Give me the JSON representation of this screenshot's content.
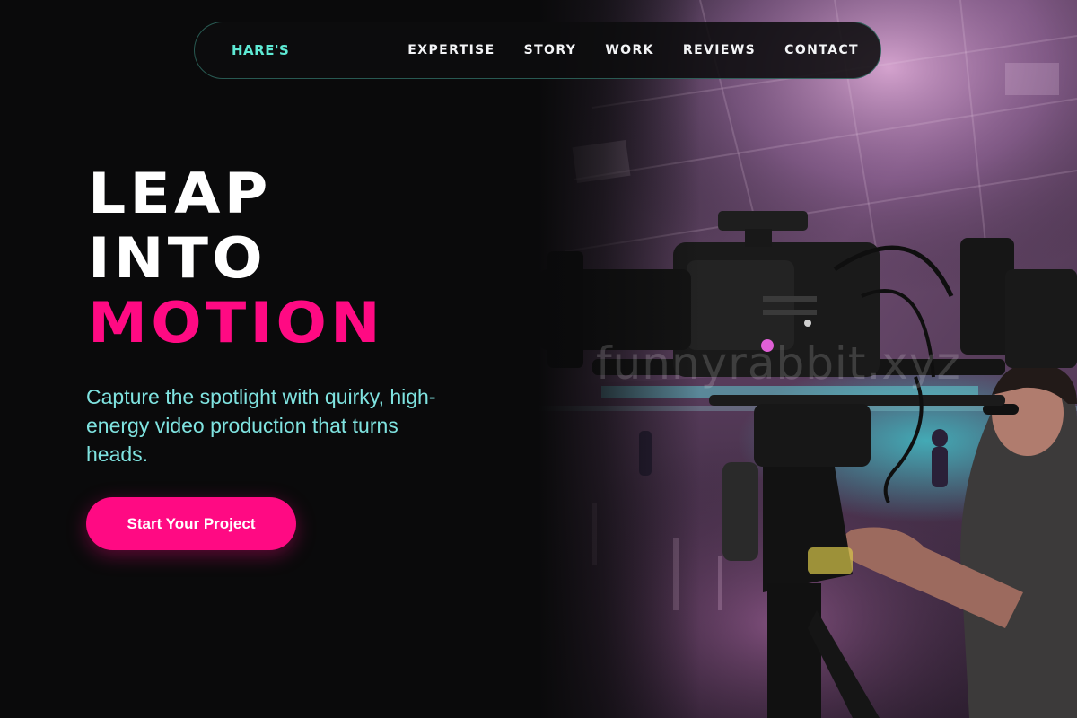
{
  "brand": {
    "logo_text": "HARE'S"
  },
  "nav": {
    "links": [
      {
        "label": "EXPERTISE"
      },
      {
        "label": "STORY"
      },
      {
        "label": "WORK"
      },
      {
        "label": "REVIEWS"
      },
      {
        "label": "CONTACT"
      }
    ]
  },
  "hero": {
    "headline_line1": "LEAP",
    "headline_line2": "INTO",
    "headline_line3": "MOTION",
    "tagline": "Capture the spotlight with quirky, high-energy video production that turns heads.",
    "cta_label": "Start Your Project",
    "image_alt": "Camera operator filming with a cinema camera rig in a purple-lit hall",
    "watermark": "funnyrabbit.xyz"
  },
  "colors": {
    "background": "#0a0a0b",
    "accent_pink": "#ff0a83",
    "accent_teal": "#5eead4",
    "tagline_teal": "#7fe3e0",
    "text_white": "#ffffff"
  }
}
